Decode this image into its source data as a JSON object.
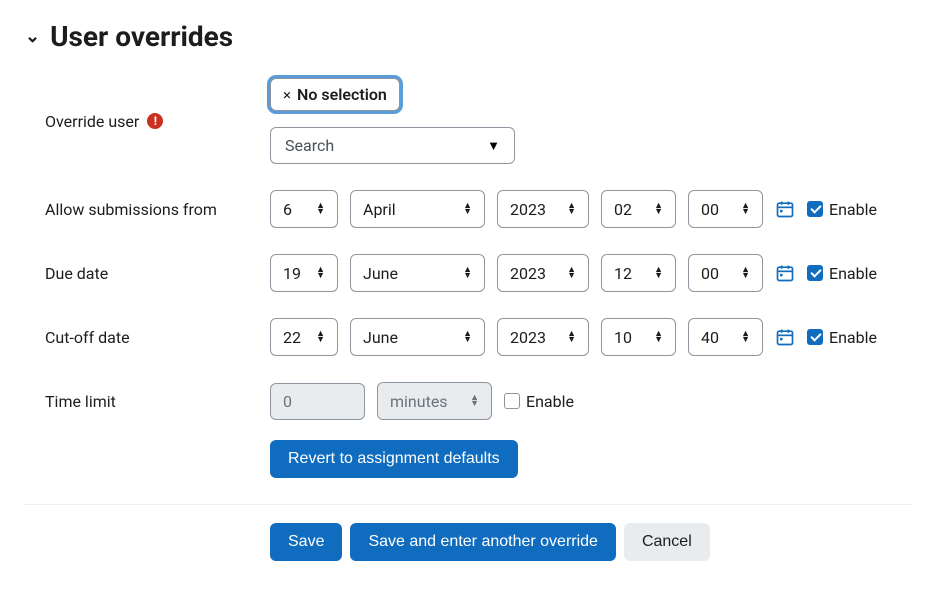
{
  "heading": "User overrides",
  "labels": {
    "override_user": "Override user",
    "allow_from": "Allow submissions from",
    "due_date": "Due date",
    "cutoff": "Cut-off date",
    "time_limit": "Time limit",
    "enable": "Enable"
  },
  "user_selection": {
    "badge": "No selection",
    "search_placeholder": "Search"
  },
  "allow_from": {
    "day": "6",
    "month": "April",
    "year": "2023",
    "hour": "02",
    "minute": "00",
    "enabled": true
  },
  "due_date": {
    "day": "19",
    "month": "June",
    "year": "2023",
    "hour": "12",
    "minute": "00",
    "enabled": true
  },
  "cutoff": {
    "day": "22",
    "month": "June",
    "year": "2023",
    "hour": "10",
    "minute": "40",
    "enabled": true
  },
  "time_limit": {
    "value": "0",
    "unit": "minutes",
    "enabled": false
  },
  "buttons": {
    "revert": "Revert to assignment defaults",
    "save": "Save",
    "save_another": "Save and enter another override",
    "cancel": "Cancel"
  }
}
